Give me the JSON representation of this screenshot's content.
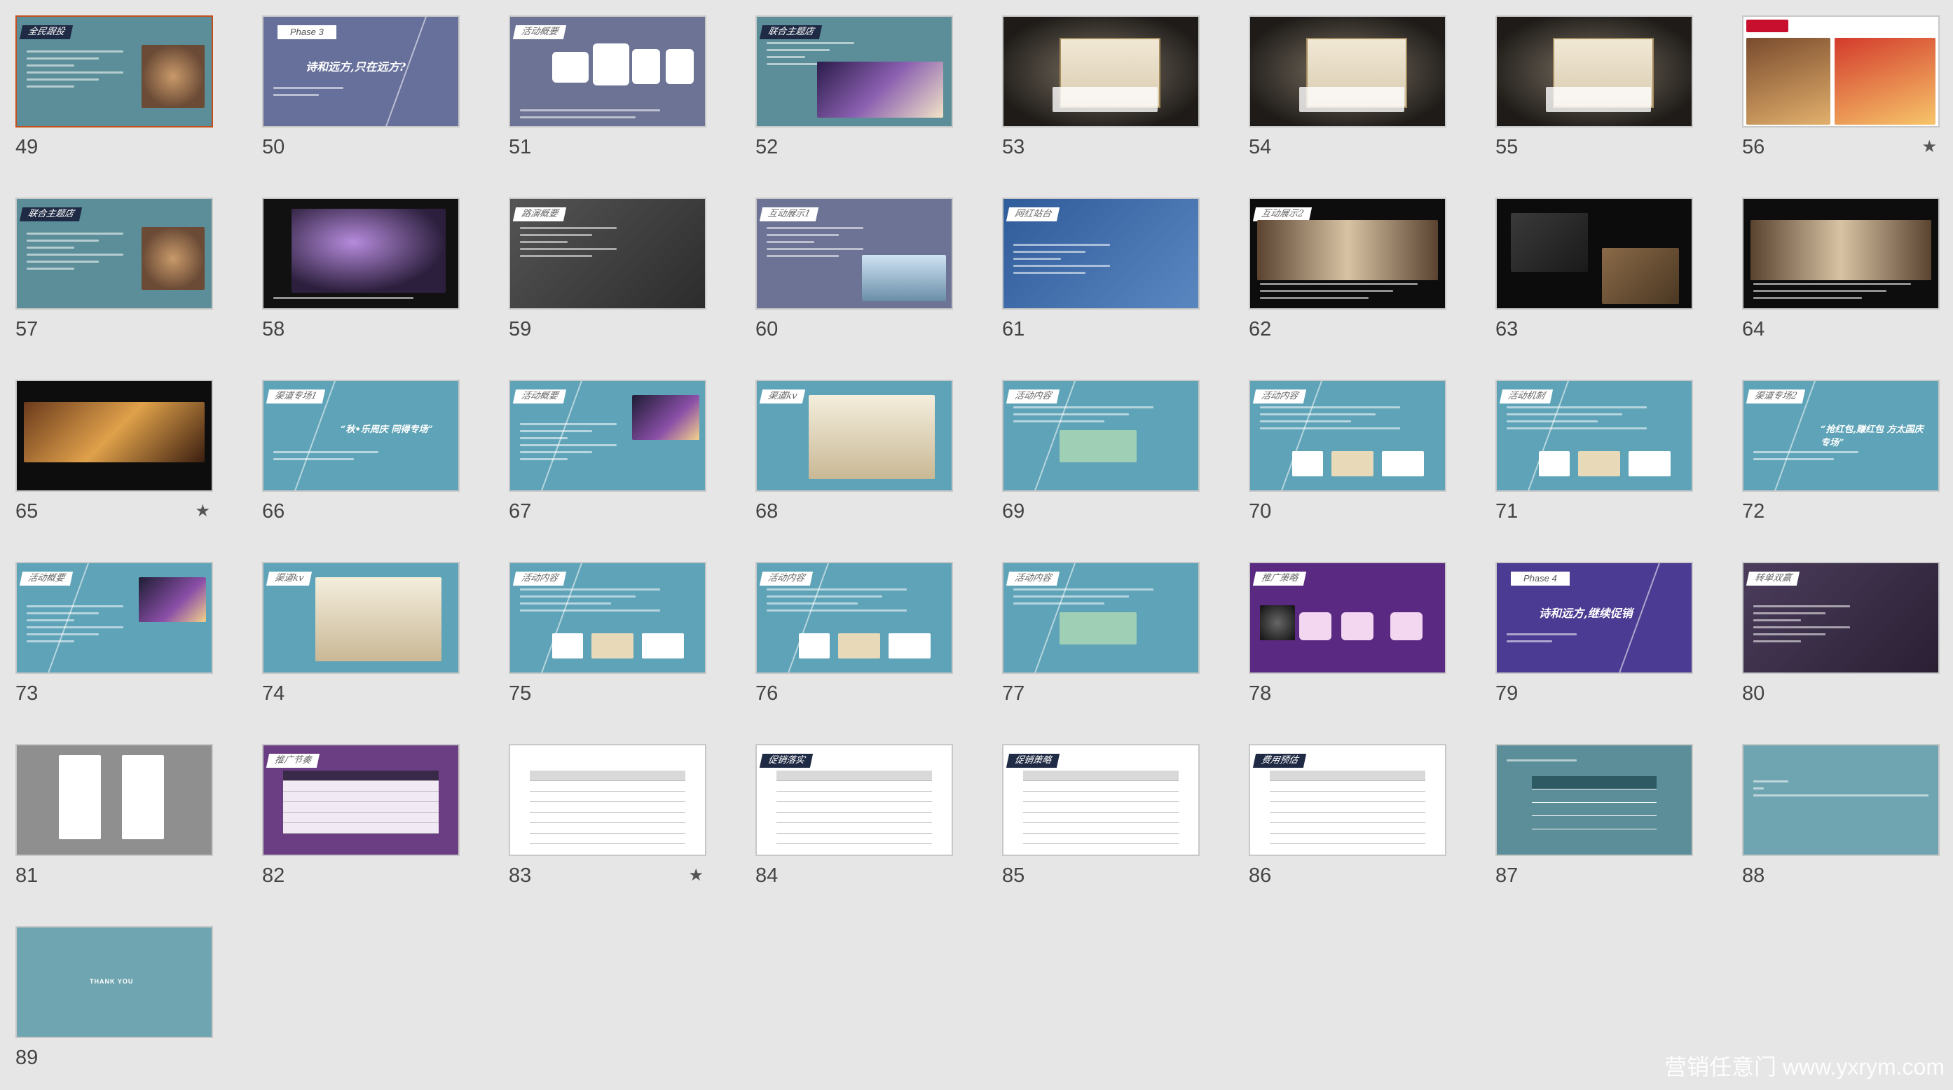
{
  "app": {
    "view": "slide-sorter",
    "watermark": "营销任意门 www.yxrym.com"
  },
  "colors": {
    "background": "#e6e6e6",
    "teal": "#5b8e98",
    "slate": "#6d7394",
    "blue_gray": "#67709b",
    "sky": "#5ea3b7",
    "purple": "#5a2a83",
    "indigo": "#4c3b92",
    "dark": "#141414",
    "white": "#ffffff",
    "gray": "#8f8f8f"
  },
  "slides": [
    {
      "num": "49",
      "kind": "teal_photo",
      "tag": "全民跟投",
      "star": false
    },
    {
      "num": "50",
      "kind": "phase",
      "tag": "Phase 3",
      "title": "诗和远方,只在远方?",
      "star": false
    },
    {
      "num": "51",
      "kind": "flow",
      "tag": "活动概要",
      "star": false
    },
    {
      "num": "52",
      "kind": "stage",
      "tag": "联合主题店",
      "star": false
    },
    {
      "num": "53",
      "kind": "kv_dark",
      "star": false
    },
    {
      "num": "54",
      "kind": "kv_dark",
      "star": false
    },
    {
      "num": "55",
      "kind": "kv_dark",
      "star": false
    },
    {
      "num": "56",
      "kind": "kfc",
      "star": true
    },
    {
      "num": "57",
      "kind": "teal_photo",
      "tag": "联合主题店",
      "star": false
    },
    {
      "num": "58",
      "kind": "dark_purple",
      "star": false
    },
    {
      "num": "59",
      "kind": "gray_photo",
      "tag": "路演概要",
      "star": false
    },
    {
      "num": "60",
      "kind": "slate_city",
      "tag": "互动展示1",
      "star": false
    },
    {
      "num": "61",
      "kind": "blue_photo",
      "tag": "网红站台",
      "star": false
    },
    {
      "num": "62",
      "kind": "dark_room",
      "tag": "互动展示2",
      "star": false
    },
    {
      "num": "63",
      "kind": "dark_box",
      "star": false
    },
    {
      "num": "64",
      "kind": "dark_room",
      "star": false
    },
    {
      "num": "65",
      "kind": "dark_room2",
      "star": true
    },
    {
      "num": "66",
      "kind": "sky_text",
      "tag": "渠道专场1",
      "title": "“秋•乐周庆 同得专场”",
      "star": false
    },
    {
      "num": "67",
      "kind": "sky_photo",
      "tag": "活动概要",
      "star": false
    },
    {
      "num": "68",
      "kind": "sky_kv",
      "tag": "渠道kv",
      "star": false
    },
    {
      "num": "69",
      "kind": "sky_box",
      "tag": "活动内容",
      "star": false
    },
    {
      "num": "70",
      "kind": "sky_products",
      "tag": "活动内容",
      "star": false
    },
    {
      "num": "71",
      "kind": "sky_products",
      "tag": "活动机制",
      "star": false
    },
    {
      "num": "72",
      "kind": "sky_text",
      "tag": "渠道专场2",
      "title": "“抢红包,赚红包 方太国庆专场”",
      "star": false
    },
    {
      "num": "73",
      "kind": "sky_photo",
      "tag": "活动概要",
      "star": false
    },
    {
      "num": "74",
      "kind": "sky_kv",
      "tag": "渠道kv",
      "star": false
    },
    {
      "num": "75",
      "kind": "sky_products",
      "tag": "活动内容",
      "star": false
    },
    {
      "num": "76",
      "kind": "sky_products",
      "tag": "活动内容",
      "star": false
    },
    {
      "num": "77",
      "kind": "sky_box",
      "tag": "活动内容",
      "star": false
    },
    {
      "num": "78",
      "kind": "purple_flow",
      "tag": "推广策略",
      "star": false
    },
    {
      "num": "79",
      "kind": "indigo_phase",
      "tag": "Phase 4",
      "title": "诗和远方,继续促销",
      "star": false
    },
    {
      "num": "80",
      "kind": "dark_hands",
      "tag": "转单双赢",
      "star": false
    },
    {
      "num": "81",
      "kind": "gray_phones",
      "star": false
    },
    {
      "num": "82",
      "kind": "purple_table",
      "tag": "推广节奏",
      "star": false
    },
    {
      "num": "83",
      "kind": "white_table",
      "star": true
    },
    {
      "num": "84",
      "kind": "white_table",
      "tag": "促销落实",
      "star": false
    },
    {
      "num": "85",
      "kind": "white_table",
      "tag": "促销策略",
      "star": false
    },
    {
      "num": "86",
      "kind": "white_table",
      "tag": "费用预估",
      "star": false
    },
    {
      "num": "87",
      "kind": "teal_table",
      "star": false
    },
    {
      "num": "88",
      "kind": "teal_text",
      "star": false
    },
    {
      "num": "89",
      "kind": "thanks",
      "title": "THANK YOU",
      "star": false
    }
  ],
  "selected_slide": "49"
}
